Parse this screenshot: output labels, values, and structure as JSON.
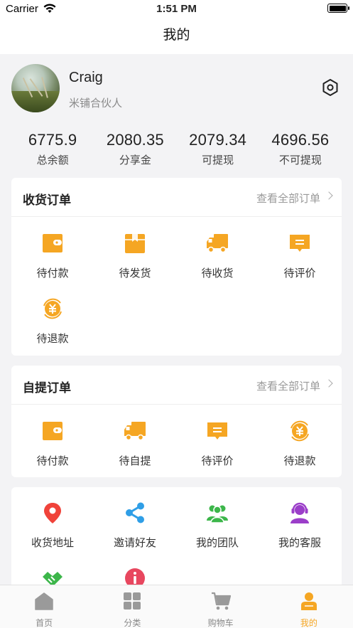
{
  "status_bar": {
    "carrier": "Carrier",
    "time": "1:51 PM"
  },
  "nav": {
    "title": "我的"
  },
  "profile": {
    "name": "Craig",
    "role": "米铺合伙人"
  },
  "stats": [
    {
      "value": "6775.9",
      "label": "总余额"
    },
    {
      "value": "2080.35",
      "label": "分享金"
    },
    {
      "value": "2079.34",
      "label": "可提现"
    },
    {
      "value": "4696.56",
      "label": "不可提现"
    }
  ],
  "delivery_orders": {
    "title": "收货订单",
    "more": "查看全部订单",
    "items": [
      {
        "label": "待付款",
        "icon": "wallet-icon"
      },
      {
        "label": "待发货",
        "icon": "box-icon"
      },
      {
        "label": "待收货",
        "icon": "truck-icon"
      },
      {
        "label": "待评价",
        "icon": "comment-icon"
      },
      {
        "label": "待退款",
        "icon": "refund-icon"
      }
    ]
  },
  "pickup_orders": {
    "title": "自提订单",
    "more": "查看全部订单",
    "items": [
      {
        "label": "待付款",
        "icon": "wallet-icon"
      },
      {
        "label": "待自提",
        "icon": "truck-icon"
      },
      {
        "label": "待评价",
        "icon": "comment-icon"
      },
      {
        "label": "待退款",
        "icon": "refund-icon"
      }
    ]
  },
  "services": {
    "items": [
      {
        "label": "收货地址",
        "icon": "location-pin-icon"
      },
      {
        "label": "邀请好友",
        "icon": "share-icon"
      },
      {
        "label": "我的团队",
        "icon": "team-icon"
      },
      {
        "label": "我的客服",
        "icon": "customer-service-icon"
      }
    ]
  },
  "tabbar": [
    {
      "label": "首页",
      "icon": "home-icon"
    },
    {
      "label": "分类",
      "icon": "category-icon"
    },
    {
      "label": "购物车",
      "icon": "cart-icon"
    },
    {
      "label": "我的",
      "icon": "profile-icon"
    }
  ],
  "colors": {
    "accent": "#f5a623",
    "background": "#f3f3f5",
    "pin": "#f0433a",
    "share": "#2f9ee6",
    "team": "#3cb64a",
    "service": "#9b3ec9"
  }
}
